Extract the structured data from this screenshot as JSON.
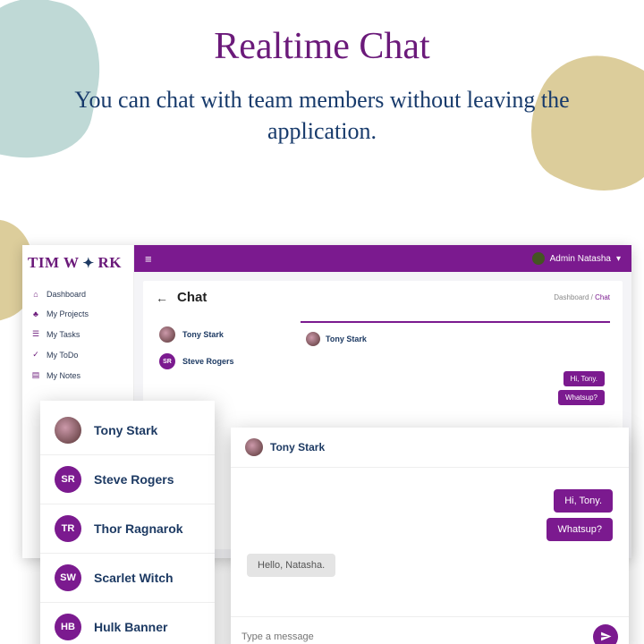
{
  "hero": {
    "title": "Realtime Chat",
    "subtitle": "You can chat with team members without leaving the application."
  },
  "logo": {
    "part1": "TIM W",
    "part2": "RK"
  },
  "sidebar": {
    "items": [
      {
        "icon": "home-icon",
        "glyph": "⌂",
        "label": "Dashboard"
      },
      {
        "icon": "user-icon",
        "glyph": "♣",
        "label": "My Projects"
      },
      {
        "icon": "tasks-icon",
        "glyph": "☰",
        "label": "My Tasks"
      },
      {
        "icon": "todo-icon",
        "glyph": "✓",
        "label": "My ToDo"
      },
      {
        "icon": "notes-icon",
        "glyph": "▤",
        "label": "My Notes"
      }
    ]
  },
  "topbar": {
    "user_name": "Admin Natasha",
    "caret": "▾"
  },
  "panel": {
    "title": "Chat",
    "back_glyph": "←",
    "breadcrumb_root": "Dashboard",
    "breadcrumb_sep": " / ",
    "breadcrumb_current": "Chat"
  },
  "contacts_small": [
    {
      "name": "Tony Stark",
      "initials": "",
      "photo": true
    },
    {
      "name": "Steve Rogers",
      "initials": "SR",
      "photo": false
    }
  ],
  "thread_small": {
    "name": "Tony Stark",
    "messages": [
      "Hi, Tony.",
      "Whatsup?"
    ]
  },
  "contacts_card": [
    {
      "name": "Tony Stark",
      "initials": "",
      "photo": true
    },
    {
      "name": "Steve Rogers",
      "initials": "SR",
      "photo": false
    },
    {
      "name": "Thor Ragnarok",
      "initials": "TR",
      "photo": false
    },
    {
      "name": "Scarlet Witch",
      "initials": "SW",
      "photo": false
    },
    {
      "name": "Hulk Banner",
      "initials": "HB",
      "photo": false
    }
  ],
  "chat_card": {
    "name": "Tony Stark",
    "out": [
      "Hi, Tony.",
      "Whatsup?"
    ],
    "in": [
      "Hello, Natasha."
    ],
    "placeholder": "Type a message"
  }
}
